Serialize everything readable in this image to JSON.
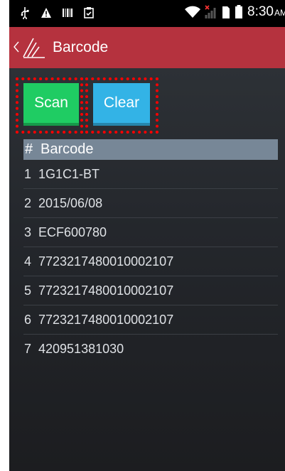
{
  "status_bar": {
    "time": "8:30",
    "ampm": "AM",
    "icons": [
      "usb-icon",
      "warning-icon",
      "barcode-notification-icon",
      "clipboard-icon",
      "wifi-icon",
      "no-signal-icon",
      "sim-icon",
      "battery-icon"
    ]
  },
  "action_bar": {
    "title": "Barcode",
    "color": "#b5323e"
  },
  "buttons": {
    "scan_label": "Scan",
    "clear_label": "Clear",
    "scan_color": "#1fcc63",
    "clear_color": "#33b3e6",
    "highlight_color": "#ff0000"
  },
  "table": {
    "headers": [
      "#",
      "Barcode"
    ],
    "rows": [
      {
        "num": "1",
        "code": "1G1C1-BT"
      },
      {
        "num": "2",
        "code": "2015/06/08"
      },
      {
        "num": "3",
        "code": "ECF600780"
      },
      {
        "num": "4",
        "code": "7723217480010002107"
      },
      {
        "num": "5",
        "code": "7723217480010002107"
      },
      {
        "num": "6",
        "code": "7723217480010002107"
      },
      {
        "num": "7",
        "code": "420951381030"
      }
    ]
  }
}
